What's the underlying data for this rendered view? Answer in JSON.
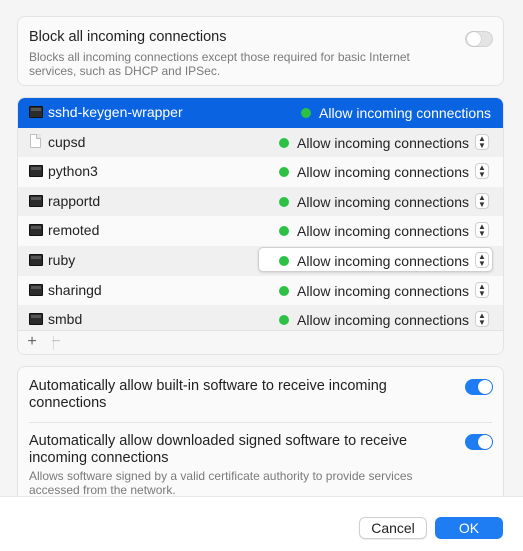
{
  "block": {
    "title": "Block all incoming connections",
    "description": "Blocks all incoming connections except those required for basic Internet services, such as DHCP and IPSec.",
    "toggle_on": false
  },
  "apps": [
    {
      "name": "sshd-keygen-wrapper",
      "status": "Allow incoming connections",
      "icon": "terminal-icon",
      "selected": true
    },
    {
      "name": "cupsd",
      "status": "Allow incoming connections",
      "icon": "file-icon"
    },
    {
      "name": "python3",
      "status": "Allow incoming connections",
      "icon": "terminal-icon"
    },
    {
      "name": "rapportd",
      "status": "Allow incoming connections",
      "icon": "terminal-icon"
    },
    {
      "name": "remoted",
      "status": "Allow incoming connections",
      "icon": "terminal-icon"
    },
    {
      "name": "ruby",
      "status": "Allow incoming connections",
      "icon": "terminal-icon",
      "focused": true
    },
    {
      "name": "sharingd",
      "status": "Allow incoming connections",
      "icon": "terminal-icon"
    },
    {
      "name": "smbd",
      "status": "Allow incoming connections",
      "icon": "terminal-icon"
    }
  ],
  "list_footer": {
    "add": "+",
    "remove": "−"
  },
  "auto_builtin": {
    "label": "Automatically allow built-in software to receive incoming connections",
    "toggle_on": true
  },
  "auto_signed": {
    "label": "Automatically allow downloaded signed software to receive incoming connections",
    "description": "Allows software signed by a valid certificate authority to provide services accessed from the network.",
    "toggle_on": true
  },
  "buttons": {
    "cancel": "Cancel",
    "ok": "OK"
  },
  "colors": {
    "accent": "#1f7df4",
    "selection": "#0a63e0",
    "status_green": "#2cc144"
  }
}
